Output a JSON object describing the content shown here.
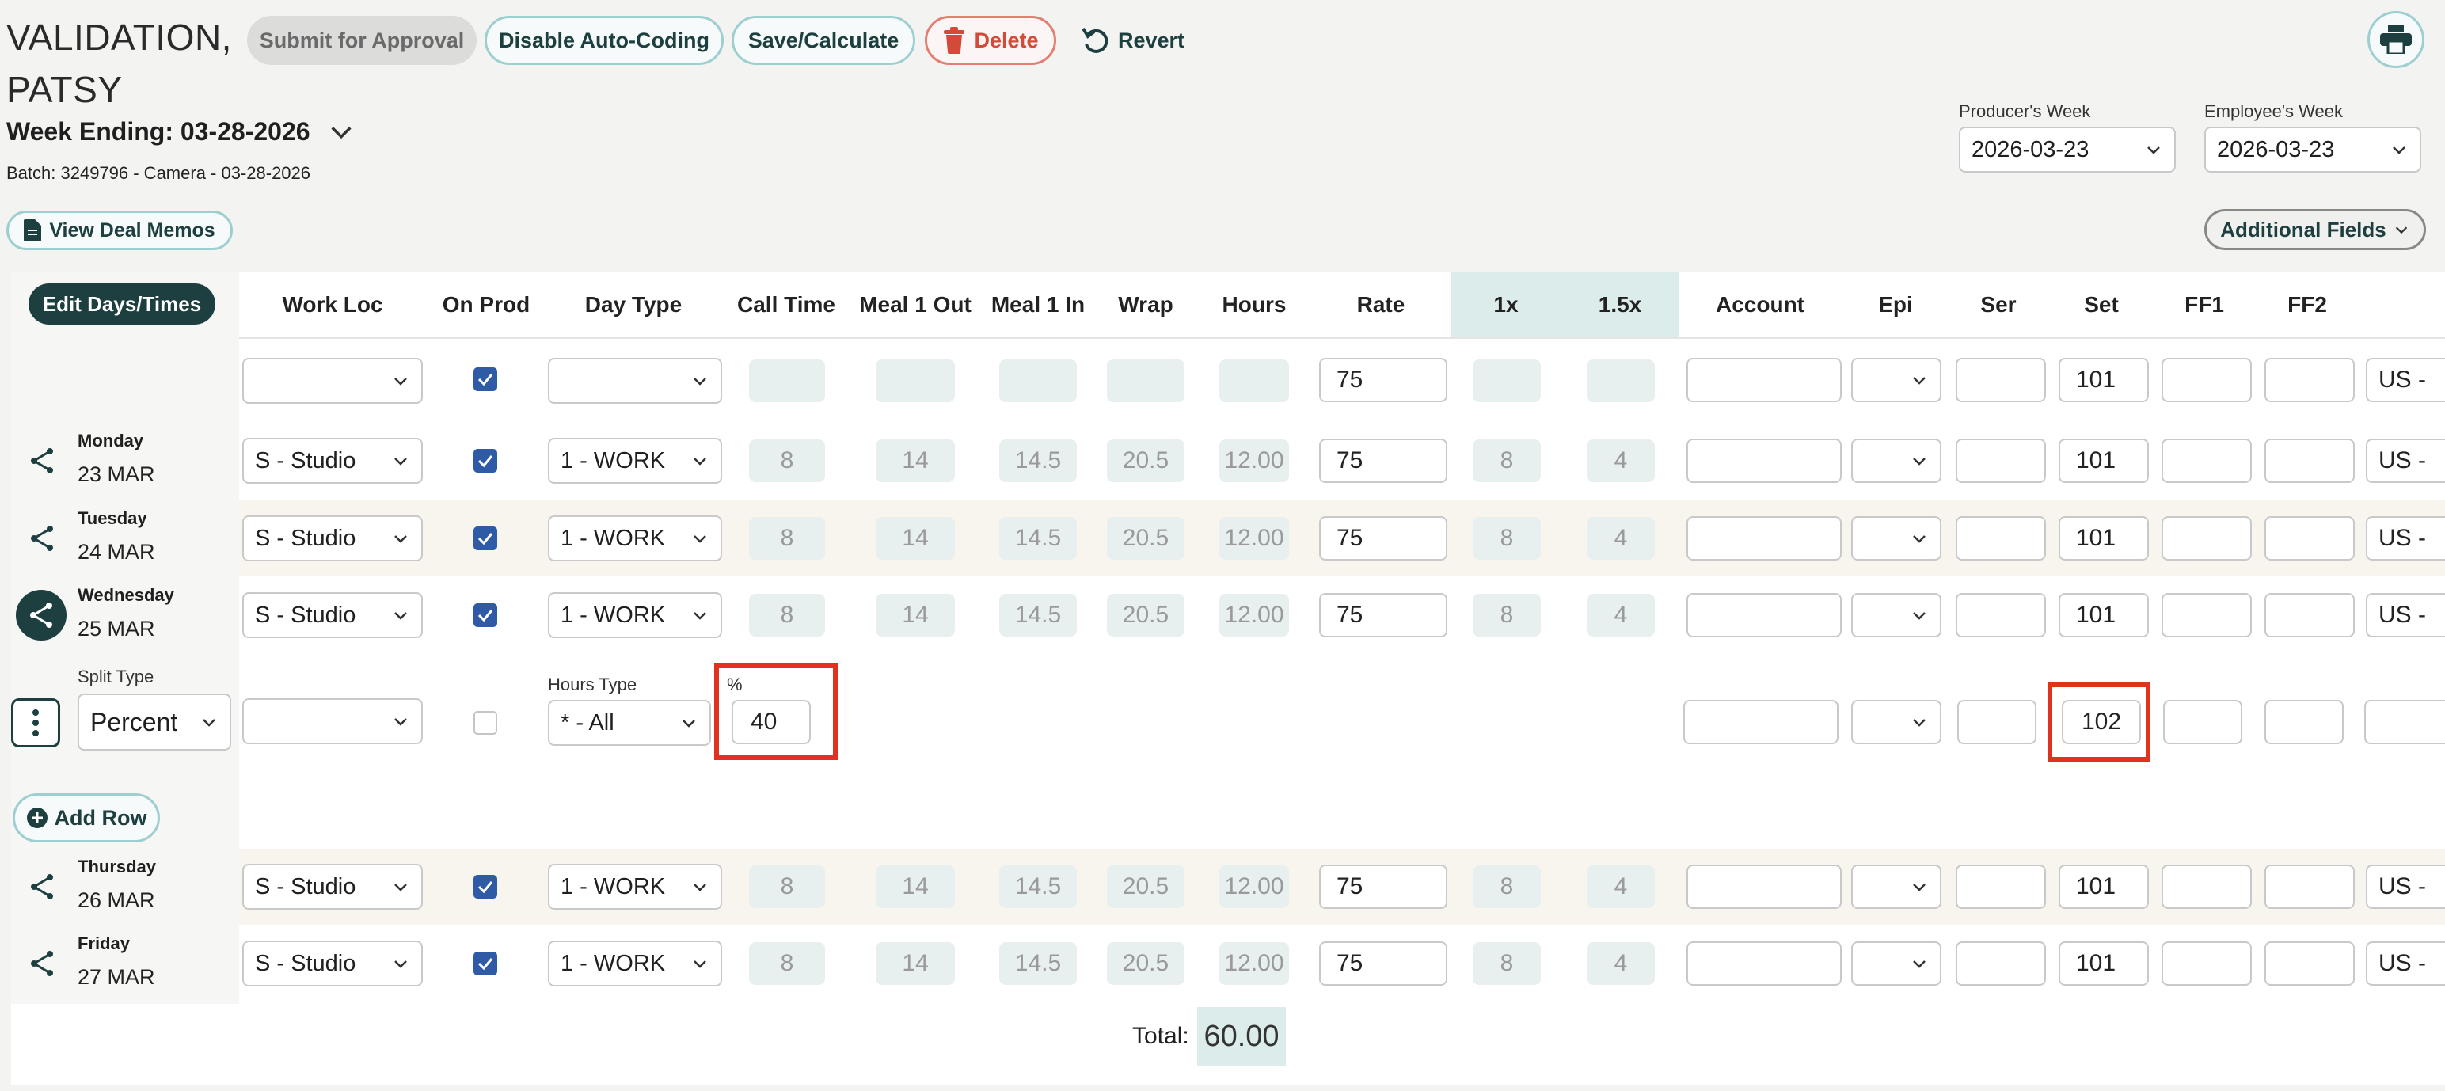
{
  "employee_name": "VALIDATION, PATSY",
  "week_ending": "Week Ending: 03-28-2026",
  "batch": "Batch: 3249796 - Camera - 03-28-2026",
  "actions": {
    "submit": "Submit for Approval",
    "disable_autocoding": "Disable Auto-Coding",
    "save": "Save/Calculate",
    "delete": "Delete",
    "revert": "Revert",
    "view_deal_memos": "View Deal Memos",
    "additional_fields": "Additional Fields",
    "edit_days": "Edit Days/Times",
    "add_row": "Add Row"
  },
  "producers_week": {
    "label": "Producer's Week",
    "value": "2026-03-23"
  },
  "employees_week": {
    "label": "Employee's Week",
    "value": "2026-03-23"
  },
  "columns": [
    "Work Loc",
    "On Prod",
    "Day Type",
    "Call Time",
    "Meal 1 Out",
    "Meal 1 In",
    "Wrap",
    "Hours",
    "Rate",
    "1x",
    "1.5x",
    "Account",
    "Epi",
    "Ser",
    "Set",
    "FF1",
    "FF2"
  ],
  "default_row": {
    "rate": "75",
    "set": "101",
    "country": "US -"
  },
  "days": [
    {
      "name": "Monday",
      "date": "23 MAR",
      "work_loc": "S - Studio",
      "day_type": "1 - WORK",
      "call": "8",
      "m1out": "14",
      "m1in": "14.5",
      "wrap": "20.5",
      "hours": "12.00",
      "rate": "75",
      "x1": "8",
      "x15": "4",
      "set": "101",
      "country": "US -"
    },
    {
      "name": "Tuesday",
      "date": "24 MAR",
      "work_loc": "S - Studio",
      "day_type": "1 - WORK",
      "call": "8",
      "m1out": "14",
      "m1in": "14.5",
      "wrap": "20.5",
      "hours": "12.00",
      "rate": "75",
      "x1": "8",
      "x15": "4",
      "set": "101",
      "country": "US -"
    },
    {
      "name": "Wednesday",
      "date": "25 MAR",
      "work_loc": "S - Studio",
      "day_type": "1 - WORK",
      "call": "8",
      "m1out": "14",
      "m1in": "14.5",
      "wrap": "20.5",
      "hours": "12.00",
      "rate": "75",
      "x1": "8",
      "x15": "4",
      "set": "101",
      "country": "US -"
    },
    {
      "name": "Thursday",
      "date": "26 MAR",
      "work_loc": "S - Studio",
      "day_type": "1 - WORK",
      "call": "8",
      "m1out": "14",
      "m1in": "14.5",
      "wrap": "20.5",
      "hours": "12.00",
      "rate": "75",
      "x1": "8",
      "x15": "4",
      "set": "101",
      "country": "US -"
    },
    {
      "name": "Friday",
      "date": "27 MAR",
      "work_loc": "S - Studio",
      "day_type": "1 - WORK",
      "call": "8",
      "m1out": "14",
      "m1in": "14.5",
      "wrap": "20.5",
      "hours": "12.00",
      "rate": "75",
      "x1": "8",
      "x15": "4",
      "set": "101",
      "country": "US -"
    }
  ],
  "split": {
    "split_type_label": "Split Type",
    "split_type": "Percent",
    "hours_type_label": "Hours Type",
    "hours_type": "* - All",
    "percent_label": "%",
    "percent": "40",
    "set": "102"
  },
  "total_label": "Total:",
  "total_value": "60.00",
  "colors": {
    "accent": "#1d3f3f",
    "teal_border": "#9ecfd0",
    "highlight": "#e0321e",
    "checkbox": "#2f5aa6"
  }
}
